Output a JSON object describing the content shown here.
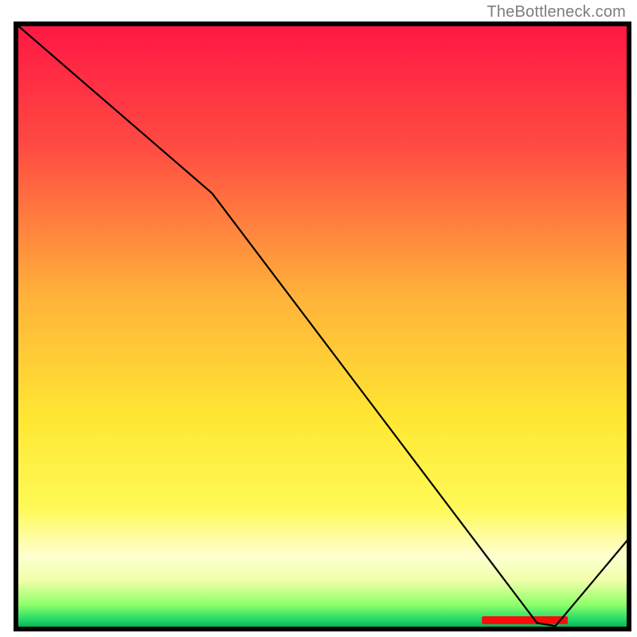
{
  "attribution": "TheBottleneck.com",
  "chart_data": {
    "type": "line",
    "title": "",
    "xlabel": "",
    "ylabel": "",
    "xlim": [
      0,
      100
    ],
    "ylim": [
      0,
      100
    ],
    "series": [
      {
        "name": "curve",
        "x": [
          0,
          32,
          85,
          88,
          100
        ],
        "values": [
          100,
          72,
          1,
          0.5,
          15
        ]
      }
    ],
    "gradient_stops": [
      {
        "offset": 0.0,
        "color": "#ff1744"
      },
      {
        "offset": 0.2,
        "color": "#ff4a42"
      },
      {
        "offset": 0.45,
        "color": "#ffb23a"
      },
      {
        "offset": 0.65,
        "color": "#ffe733"
      },
      {
        "offset": 0.8,
        "color": "#fffa57"
      },
      {
        "offset": 0.88,
        "color": "#ffffd0"
      },
      {
        "offset": 0.92,
        "color": "#f0ffa8"
      },
      {
        "offset": 0.96,
        "color": "#8dff6a"
      },
      {
        "offset": 0.985,
        "color": "#20d868"
      },
      {
        "offset": 1.0,
        "color": "#00a84e"
      }
    ],
    "marker": {
      "present": true,
      "label": "",
      "color": "#ff0a0a",
      "x_center": 83,
      "y": 0.8,
      "width": 14,
      "height": 1.3
    },
    "border_color": "#000000",
    "border_width": 6
  }
}
